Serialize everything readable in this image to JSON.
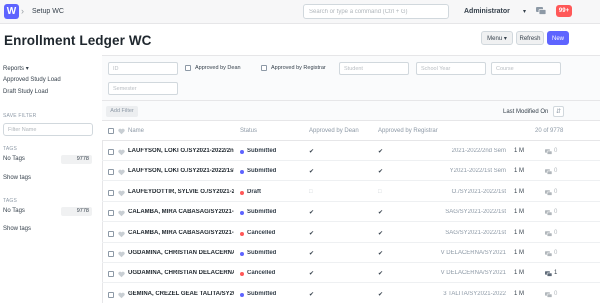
{
  "navbar": {
    "logo": "W",
    "breadcrumb": "Setup WC",
    "search_placeholder": "Search or type a command (Ctrl + G)",
    "user": "Administrator",
    "notif_count": "99+"
  },
  "page": {
    "title": "Enrollment Ledger WC",
    "menu_label": "Menu",
    "refresh_label": "Refresh",
    "new_label": "New"
  },
  "sidebar": {
    "reports_label": "Reports",
    "reports": [
      "Approved Study Load",
      "Draft Study Load"
    ],
    "save_filter_label": "SAVE FILTER",
    "filter_placeholder": "Filter Name",
    "tag_groups": [
      {
        "heading": "TAGS",
        "label": "No Tags",
        "count": "9778",
        "show": "Show tags"
      },
      {
        "heading": "TAGS",
        "label": "No Tags",
        "count": "9778",
        "show": "Show tags"
      }
    ]
  },
  "filters": {
    "id_placeholder": "ID",
    "approved_dean": "Approved by Dean",
    "approved_registrar": "Approved by Registrar",
    "student_placeholder": "Student",
    "school_year_placeholder": "School Year",
    "course_placeholder": "Course",
    "semester_placeholder": "Semester"
  },
  "list": {
    "add_filter": "Add Filter",
    "sort_label": "Last Modified On",
    "headers": {
      "name": "Name",
      "status": "Status",
      "approved_dean": "Approved by Dean",
      "approved_registrar": "Approved by Registrar",
      "count": "20 of 9778"
    },
    "rows": [
      {
        "name": "LAUFYSON, LOKI O./SY2021-2022/2nd",
        "status": "Submitted",
        "status_color": "#5e64ff",
        "dean": true,
        "registrar": true,
        "ref": "2021-2022/2nd Sem",
        "modified": "1 M",
        "comments": "0"
      },
      {
        "name": "LAUFYSON, LOKI O./SY2021-2022/1st",
        "status": "Submitted",
        "status_color": "#5e64ff",
        "dean": true,
        "registrar": true,
        "ref": "Y2021-2022/1st Sem",
        "modified": "1 M",
        "comments": "0"
      },
      {
        "name": "LAUFEYDOTTIR, SYLVIE O./SY2021-2",
        "status": "Draft",
        "status_color": "#ff5858",
        "dean": false,
        "registrar": false,
        "ref": "O./SY2021-2022/1st",
        "modified": "1 M",
        "comments": "0"
      },
      {
        "name": "CALAMBA, MIRA CABASAG/SY2021-2",
        "status": "Submitted",
        "status_color": "#5e64ff",
        "dean": true,
        "registrar": true,
        "ref": "SAG/SY2021-2022/1st",
        "modified": "1 M",
        "comments": "0"
      },
      {
        "name": "CALAMBA, MIRA CABASAG/SY2021-2",
        "status": "Cancelled",
        "status_color": "#ff5858",
        "dean": true,
        "registrar": true,
        "ref": "SAG/SY2021-2022/1st",
        "modified": "1 M",
        "comments": "0"
      },
      {
        "name": "UGDAMINA, CHRISTIAN DELACERNA/",
        "status": "Submitted",
        "status_color": "#5e64ff",
        "dean": true,
        "registrar": true,
        "ref": "V DELACERNA/SY2021",
        "modified": "1 M",
        "comments": "0"
      },
      {
        "name": "UGDAMINA, CHRISTIAN DELACERNA/",
        "status": "Cancelled",
        "status_color": "#ff5858",
        "dean": true,
        "registrar": true,
        "ref": "V DELACERNA/SY2021",
        "modified": "1 M",
        "comments": "1"
      },
      {
        "name": "GEMINA, CREZEL GEAE TALITA/SY20",
        "status": "Submitted",
        "status_color": "#5e64ff",
        "dean": true,
        "registrar": true,
        "ref": "3 TALITA/SY2021-2022",
        "modified": "1 M",
        "comments": "0"
      }
    ]
  },
  "colors": {
    "primary": "#5e64ff",
    "danger": "#ff5858"
  }
}
